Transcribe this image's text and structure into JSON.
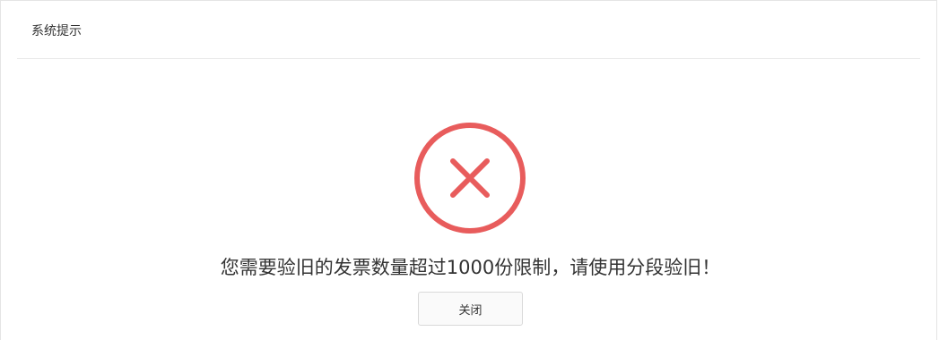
{
  "dialog": {
    "title": "系统提示",
    "icon": "error-circle-x-icon",
    "icon_color": "#e85c5c",
    "message": "您需要验旧的发票数量超过1000份限制，请使用分段验旧！",
    "close_label": "关闭"
  }
}
